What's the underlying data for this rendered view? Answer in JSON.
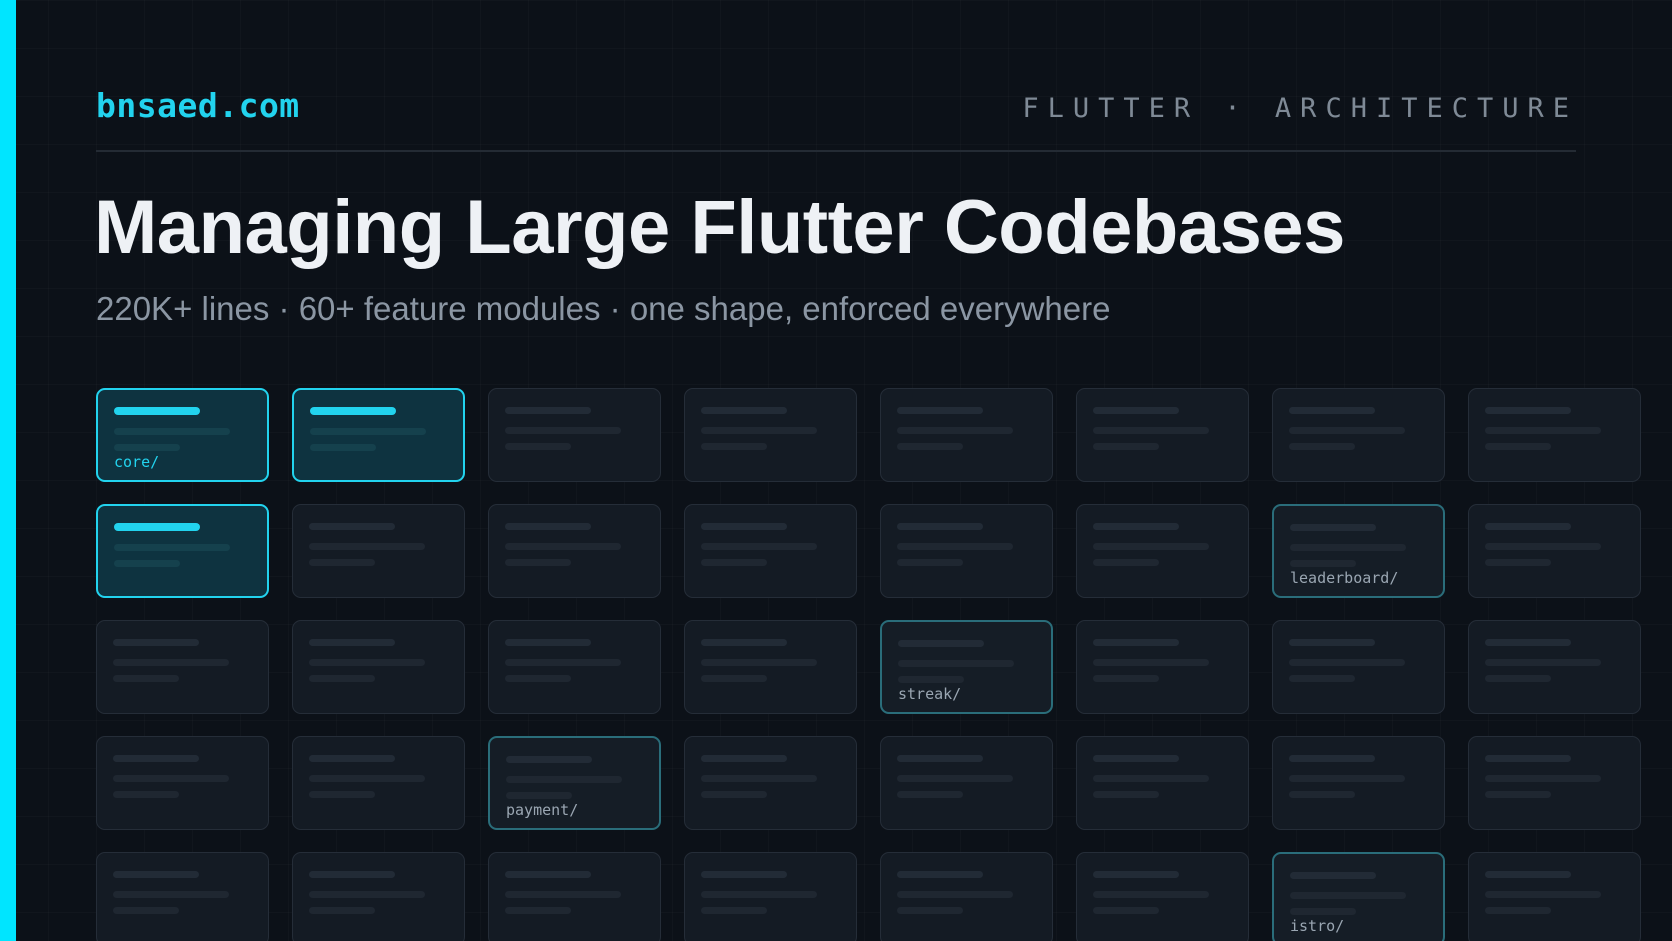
{
  "brand": "bnsaed.com",
  "kicker": "FLUTTER · ARCHITECTURE",
  "title": "Managing Large Flutter Codebases",
  "subtitle": "220K+ lines · 60+ feature modules · one shape, enforced everywhere",
  "colors": {
    "accent": "#00e5ff",
    "background": "#0c1118",
    "card": "#141b24",
    "card_active": "#0e3340",
    "marked_border": "#2a6d7a"
  },
  "module_grid": {
    "rows": [
      [
        {
          "state": "active",
          "label": "core/"
        },
        {
          "state": "active",
          "label": ""
        },
        {
          "state": "idle",
          "label": ""
        },
        {
          "state": "idle",
          "label": ""
        },
        {
          "state": "idle",
          "label": ""
        },
        {
          "state": "idle",
          "label": ""
        },
        {
          "state": "idle",
          "label": ""
        },
        {
          "state": "idle",
          "label": ""
        }
      ],
      [
        {
          "state": "active",
          "label": ""
        },
        {
          "state": "idle",
          "label": ""
        },
        {
          "state": "idle",
          "label": ""
        },
        {
          "state": "idle",
          "label": ""
        },
        {
          "state": "idle",
          "label": ""
        },
        {
          "state": "idle",
          "label": ""
        },
        {
          "state": "marked",
          "label": "leaderboard/"
        },
        {
          "state": "idle",
          "label": ""
        }
      ],
      [
        {
          "state": "idle",
          "label": ""
        },
        {
          "state": "idle",
          "label": ""
        },
        {
          "state": "idle",
          "label": ""
        },
        {
          "state": "idle",
          "label": ""
        },
        {
          "state": "marked",
          "label": "streak/"
        },
        {
          "state": "idle",
          "label": ""
        },
        {
          "state": "idle",
          "label": ""
        },
        {
          "state": "idle",
          "label": ""
        }
      ],
      [
        {
          "state": "idle",
          "label": ""
        },
        {
          "state": "idle",
          "label": ""
        },
        {
          "state": "marked",
          "label": "payment/"
        },
        {
          "state": "idle",
          "label": ""
        },
        {
          "state": "idle",
          "label": ""
        },
        {
          "state": "idle",
          "label": ""
        },
        {
          "state": "idle",
          "label": ""
        },
        {
          "state": "idle",
          "label": ""
        }
      ],
      [
        {
          "state": "idle",
          "label": ""
        },
        {
          "state": "idle",
          "label": ""
        },
        {
          "state": "idle",
          "label": ""
        },
        {
          "state": "idle",
          "label": ""
        },
        {
          "state": "idle",
          "label": ""
        },
        {
          "state": "idle",
          "label": ""
        },
        {
          "state": "marked",
          "label": "istro/"
        },
        {
          "state": "idle",
          "label": ""
        }
      ]
    ]
  }
}
